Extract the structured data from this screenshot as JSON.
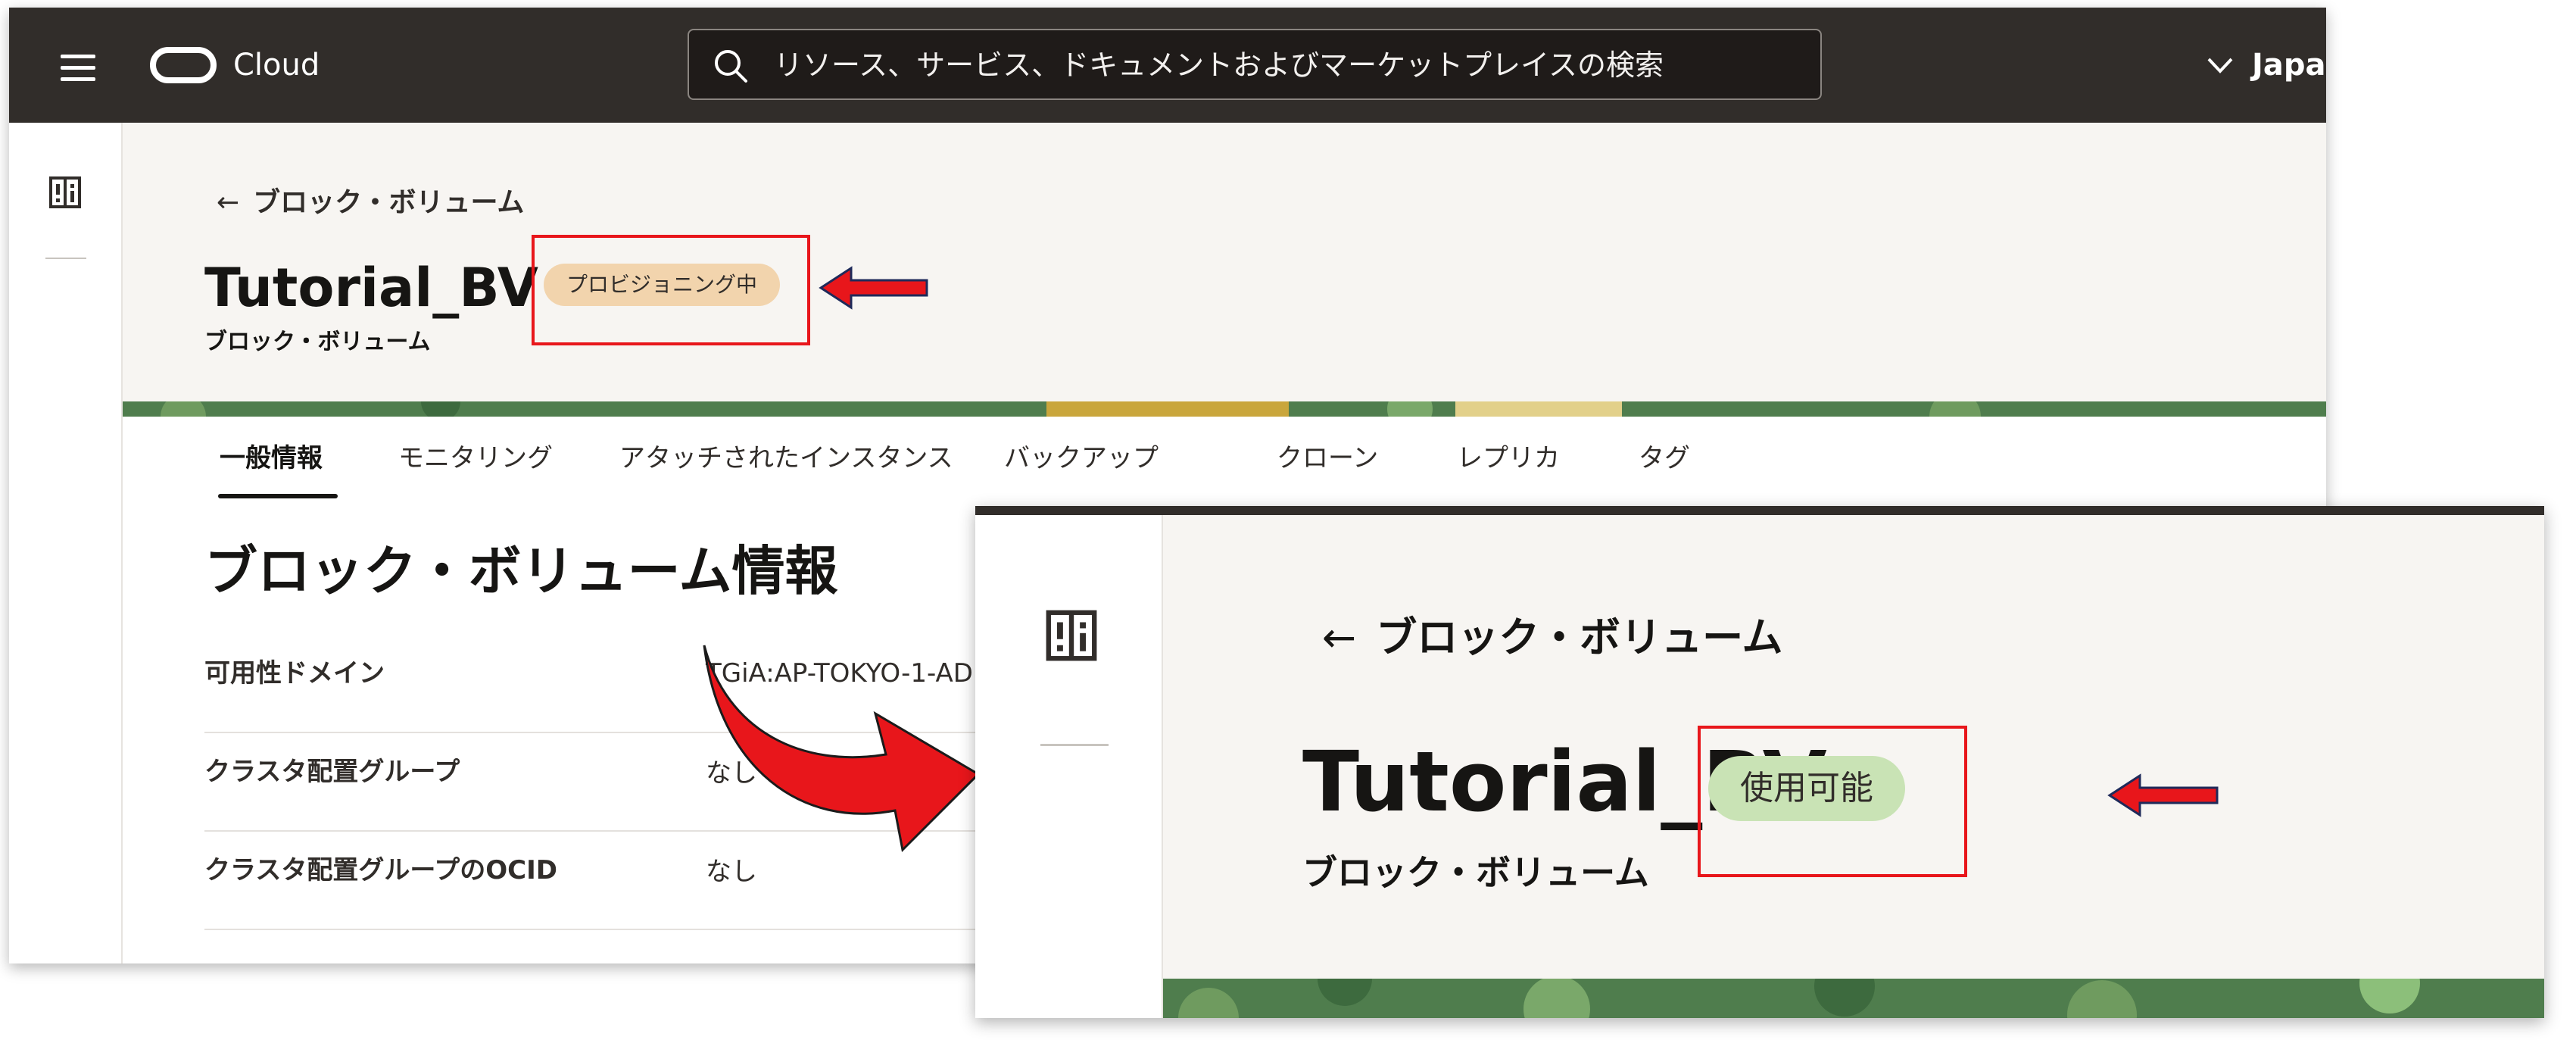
{
  "topbar": {
    "brand": "Cloud",
    "search_placeholder": "リソース、サービス、ドキュメントおよびマーケットプレイスの検索",
    "region": "Japan"
  },
  "page": {
    "back_label": "ブロック・ボリューム",
    "title": "Tutorial_BV",
    "subtitle": "ブロック・ボリューム",
    "status_badge": "プロビジョニング中"
  },
  "tabs": [
    {
      "label": "一般情報",
      "active": true
    },
    {
      "label": "モニタリング",
      "active": false
    },
    {
      "label": "アタッチされたインスタンス",
      "active": false
    },
    {
      "label": "バックアップ",
      "active": false
    },
    {
      "label": "クローン",
      "active": false
    },
    {
      "label": "レプリカ",
      "active": false
    },
    {
      "label": "タグ",
      "active": false
    }
  ],
  "section": {
    "title": "ブロック・ボリューム情報",
    "rows": [
      {
        "label": "可用性ドメイン",
        "value": "TGiA:AP-TOKYO-1-AD"
      },
      {
        "label": "クラスタ配置グループ",
        "value": "なし"
      },
      {
        "label": "クラスタ配置グループのOCID",
        "value": "なし"
      }
    ]
  },
  "zoom": {
    "back_label": "ブロック・ボリューム",
    "title": "Tutorial_BV",
    "subtitle": "ブロック・ボリューム",
    "status_badge": "使用可能"
  },
  "colors": {
    "topbar": "#312d2a",
    "header_bg": "#f7f5f2",
    "provisioning_badge": "#f2d4ad",
    "available_badge": "#c9e3b5",
    "highlight_box": "#e8161b",
    "annotation_arrow": "#e8161b"
  },
  "icons": {
    "menu": "hamburger-menu-icon",
    "logo": "oracle-cloud-logo-icon",
    "search": "search-icon",
    "region": "chevron-down-icon",
    "rail": "resource-panel-icon",
    "back": "back-arrow-icon"
  }
}
